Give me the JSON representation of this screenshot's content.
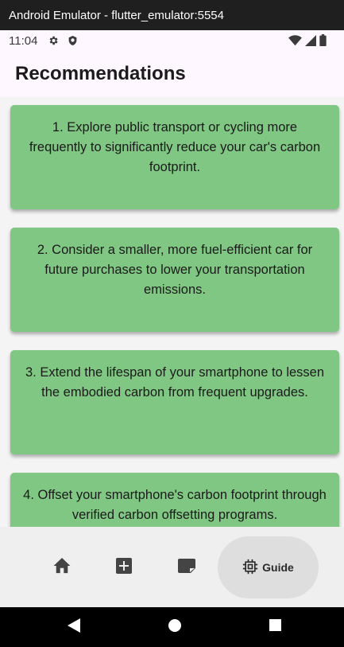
{
  "window": {
    "title": "Android Emulator - flutter_emulator:5554"
  },
  "status_bar": {
    "time": "11:04",
    "icons": [
      "gear-icon",
      "shield-icon",
      "wifi-icon",
      "signal-icon",
      "battery-icon"
    ]
  },
  "app_bar": {
    "title": "Recommendations"
  },
  "recommendations": [
    {
      "text": "1. Explore public transport or cycling more frequently to significantly reduce your car's carbon footprint."
    },
    {
      "text": "2.  Consider a smaller, more fuel-efficient car for future purchases to lower your transportation emissions."
    },
    {
      "text": "3.  Extend the lifespan of your smartphone to lessen the embodied carbon from frequent upgrades."
    },
    {
      "text": "4.  Offset your smartphone's carbon footprint through verified carbon offsetting programs."
    }
  ],
  "bottom_nav": {
    "items": [
      {
        "icon": "home-icon"
      },
      {
        "icon": "add-box-icon"
      },
      {
        "icon": "sticky-note-icon"
      },
      {
        "icon": "memory-chip-icon",
        "label": "Guide",
        "selected": true
      }
    ]
  },
  "colors": {
    "card": "#81c784",
    "background": "#fef7ff",
    "content_bg": "#f4f4f4",
    "nav_bg": "#efefef",
    "nav_selected": "#dedede"
  }
}
